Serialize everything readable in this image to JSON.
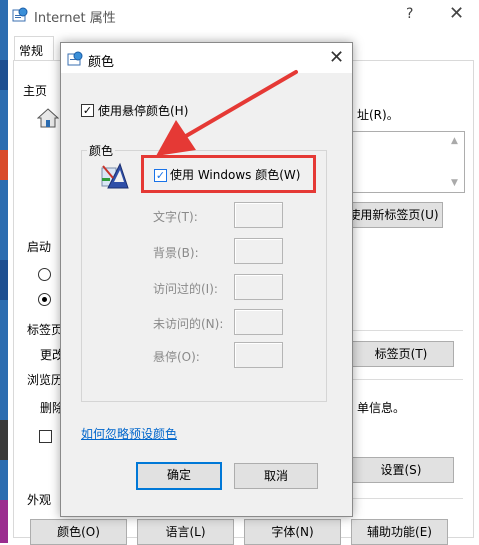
{
  "window": {
    "title": "Internet 属性",
    "help_glyph": "?",
    "close_glyph": "✕"
  },
  "tabs": {
    "general": "常规"
  },
  "general": {
    "home_label": "主页",
    "address_suffix": "址(R)。",
    "use_new_tab_button": "使用新标签页(U)",
    "startup_label": "启动",
    "tabs_section_label": "标签页",
    "change_label_partial": "更改",
    "tabs_button": "标签页(T)",
    "browsing_label_partial": "浏览历",
    "delete_label_partial": "删除",
    "single_info_text": "单信息。",
    "settings_button": "设置(S)",
    "appearance_label": "外观",
    "colors_button": "颜色(O)",
    "language_button": "语言(L)",
    "fonts_button": "字体(N)",
    "accessibility_button": "辅助功能(E)"
  },
  "dialog": {
    "title": "颜色",
    "close_glyph": "✕",
    "hover_checkbox_label": "使用悬停颜色(H)",
    "hover_checked": true,
    "group_label": "颜色",
    "use_windows_label": "使用 Windows 颜色(W)",
    "use_windows_checked": true,
    "rows": [
      {
        "label": "文字(T):"
      },
      {
        "label": "背景(B):"
      },
      {
        "label": "访问过的(I):"
      },
      {
        "label": "未访问的(N):"
      },
      {
        "label": "悬停(O):"
      }
    ],
    "link_text": "如何忽略预设颜色",
    "ok_button": "确定",
    "cancel_button": "取消"
  },
  "check_glyph": "✓",
  "colors": {
    "highlight_red": "#e53935",
    "link_blue": "#0066cc",
    "check_blue": "#1a73e8",
    "dialog_bg": "#f0f0f0"
  }
}
